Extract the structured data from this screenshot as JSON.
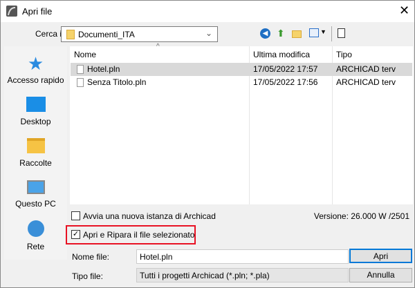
{
  "window": {
    "title": "Apri file"
  },
  "toolbar": {
    "look_in_label": "Cerca in:",
    "look_in_value": "Documenti_ITA"
  },
  "sidebar": {
    "items": [
      {
        "label": "Accesso rapido"
      },
      {
        "label": "Desktop"
      },
      {
        "label": "Raccolte"
      },
      {
        "label": "Questo PC"
      },
      {
        "label": "Rete"
      }
    ]
  },
  "list": {
    "columns": [
      "Nome",
      "Ultima modifica",
      "Tipo"
    ],
    "rows": [
      {
        "name": "Hotel.pln",
        "modified": "17/05/2022 17:57",
        "type": "ARCHICAD terv",
        "selected": true
      },
      {
        "name": "Senza Titolo.pln",
        "modified": "17/05/2022 17:56",
        "type": "ARCHICAD terv",
        "selected": false
      }
    ]
  },
  "options": {
    "new_instance_label": "Avvia una nuova istanza di Archicad",
    "new_instance_checked": false,
    "repair_label": "Apri e Ripara il file selezionato",
    "repair_checked": true,
    "version": "Versione: 26.000 W /2501"
  },
  "form": {
    "filename_label": "Nome file:",
    "filename_value": "Hotel.pln",
    "filetype_label": "Tipo file:",
    "filetype_value": "Tutti i progetti Archicad (*.pln; *.pla)",
    "open_label": "Apri",
    "cancel_label": "Annulla"
  },
  "colors": {
    "highlight": "#e81123",
    "accent": "#0078d7"
  }
}
